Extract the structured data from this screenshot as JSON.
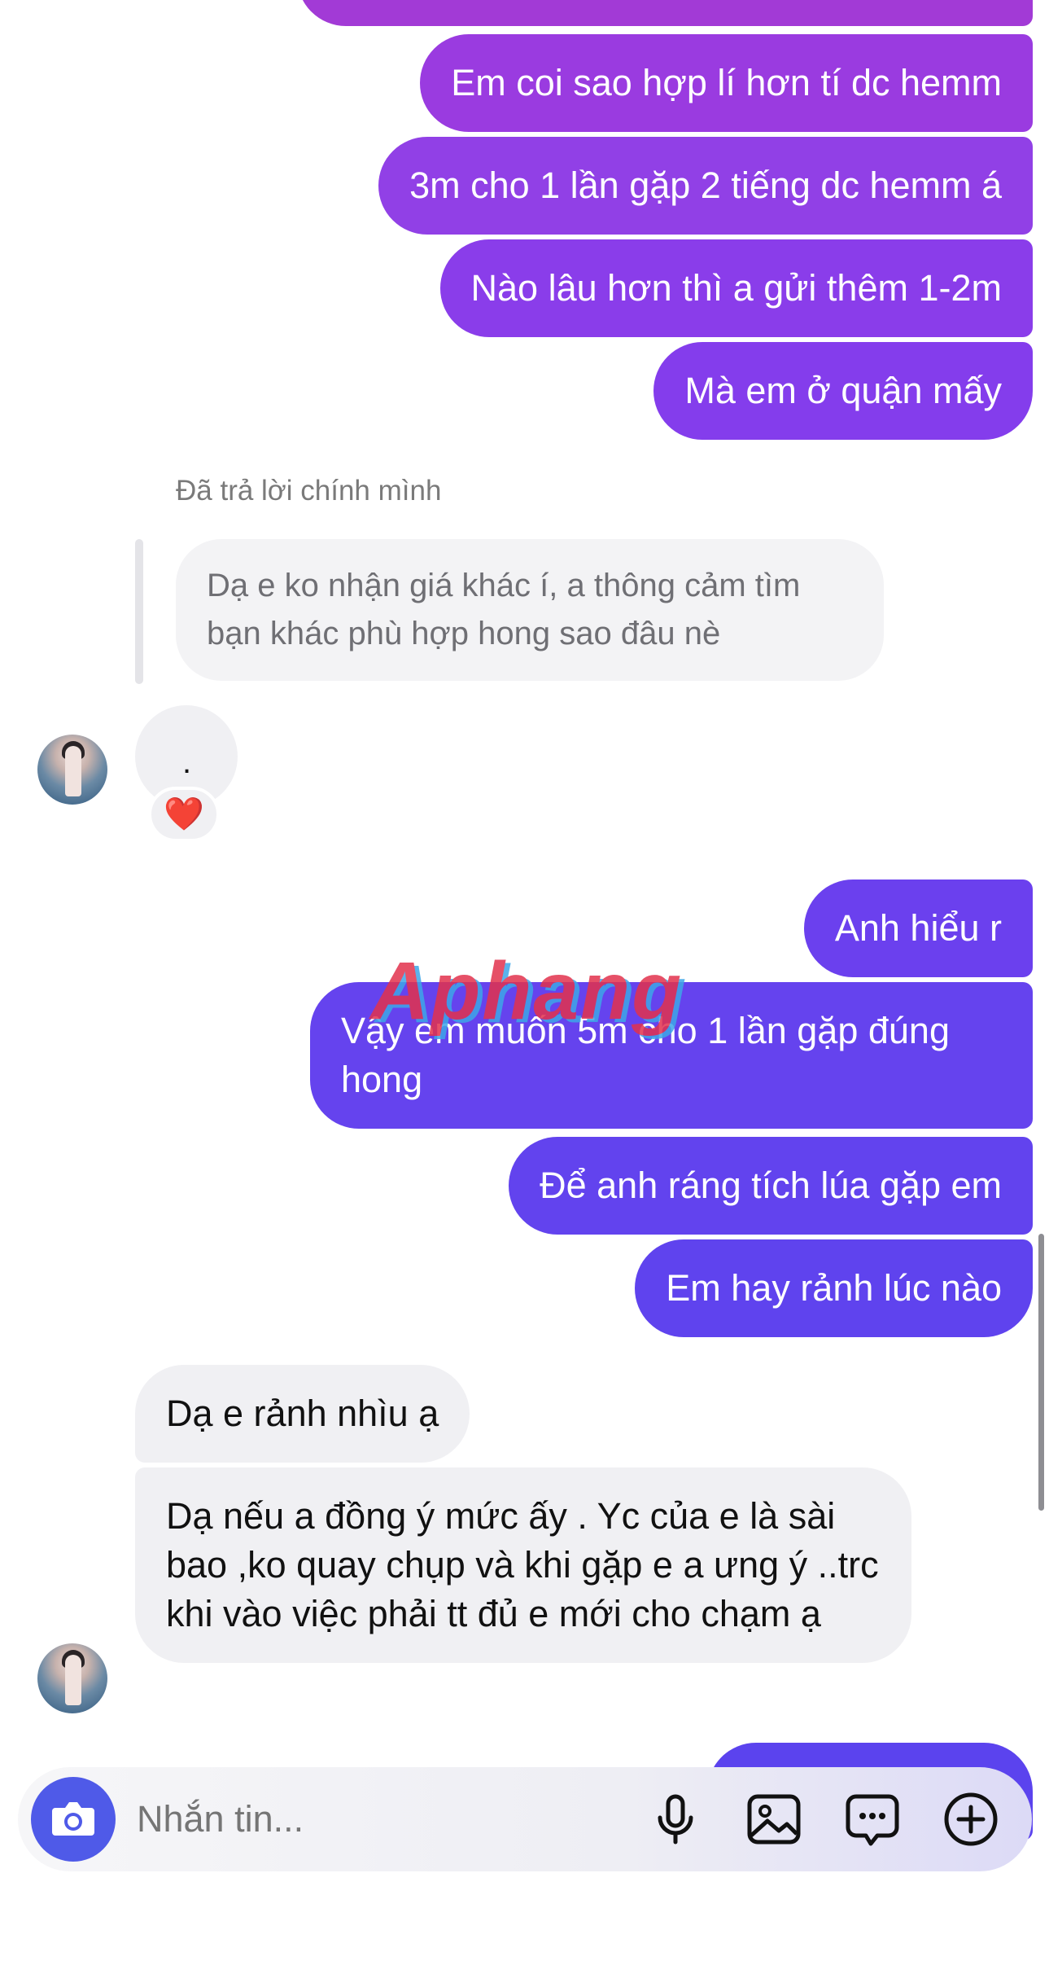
{
  "theme": {
    "out_gradient_top": "#a23ad6",
    "out_purple": "#7c3bef",
    "out_blue": "#5b43ee",
    "incoming_bg": "#f0f0f3",
    "reaction_color": "#e0182d"
  },
  "messages": {
    "out1": "Em coi sao hợp lí hơn tí dc hemm",
    "out2": "3m cho 1 lần gặp 2 tiếng dc hemm á",
    "out3": "Nào lâu hơn thì a gửi thêm 1-2m",
    "out4": "Mà em ở quận mấy",
    "reply_label": "Đã trả lời chính mình",
    "reply_quote": "Dạ e ko nhận giá khác í, a thông cảm tìm bạn khác phù hợp hong sao đâu nè",
    "dot_message": ".",
    "reaction": "❤️",
    "out5": "Anh hiểu r",
    "out6": "Vậy em muốn 5m cho 1 lần gặp đúng hong",
    "out7": "Để anh ráng tích lúa gặp em",
    "out8": "Em hay rảnh lúc nào",
    "in1": "Dạ e rảnh nhìu ạ",
    "in2": "Dạ nếu a đồng ý mức ấy . Yc của e là sài bao ,ko quay chụp và khi gặp e a ưng ý ..trc khi vào việc phải tt đủ e mới cho chạm ạ"
  },
  "watermark": "Aphang",
  "composer": {
    "placeholder": "Nhắn tin...",
    "icons": [
      "camera-icon",
      "microphone-icon",
      "image-icon",
      "sticker-icon",
      "plus-icon"
    ]
  }
}
